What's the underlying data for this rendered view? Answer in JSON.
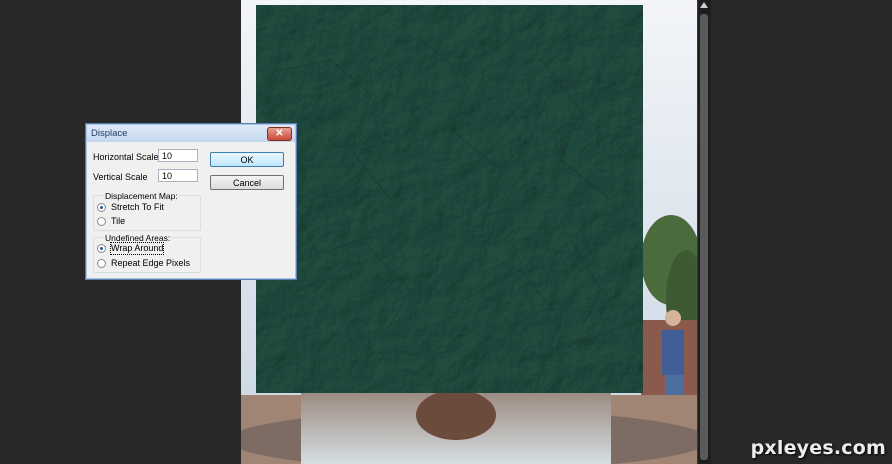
{
  "dialog": {
    "title": "Displace",
    "horizontal_scale": {
      "label": "Horizontal Scale",
      "value": "10"
    },
    "vertical_scale": {
      "label": "Vertical Scale",
      "value": "10"
    },
    "ok_label": "OK",
    "cancel_label": "Cancel",
    "displacement_map": {
      "label": "Displacement Map:",
      "options": [
        {
          "label": "Stretch To Fit",
          "checked": true
        },
        {
          "label": "Tile",
          "checked": false
        }
      ]
    },
    "undefined_areas": {
      "label": "Undefined Areas:",
      "options": [
        {
          "label": "Wrap Around",
          "checked": true
        },
        {
          "label": "Repeat Edge Pixels",
          "checked": false
        }
      ]
    }
  },
  "watermark": "pxleyes.com",
  "icons": {
    "close": "close-icon"
  },
  "colors": {
    "workspace": "#282828",
    "stone": "#4e7b70",
    "dialog_bg": "#f0f0f0"
  }
}
